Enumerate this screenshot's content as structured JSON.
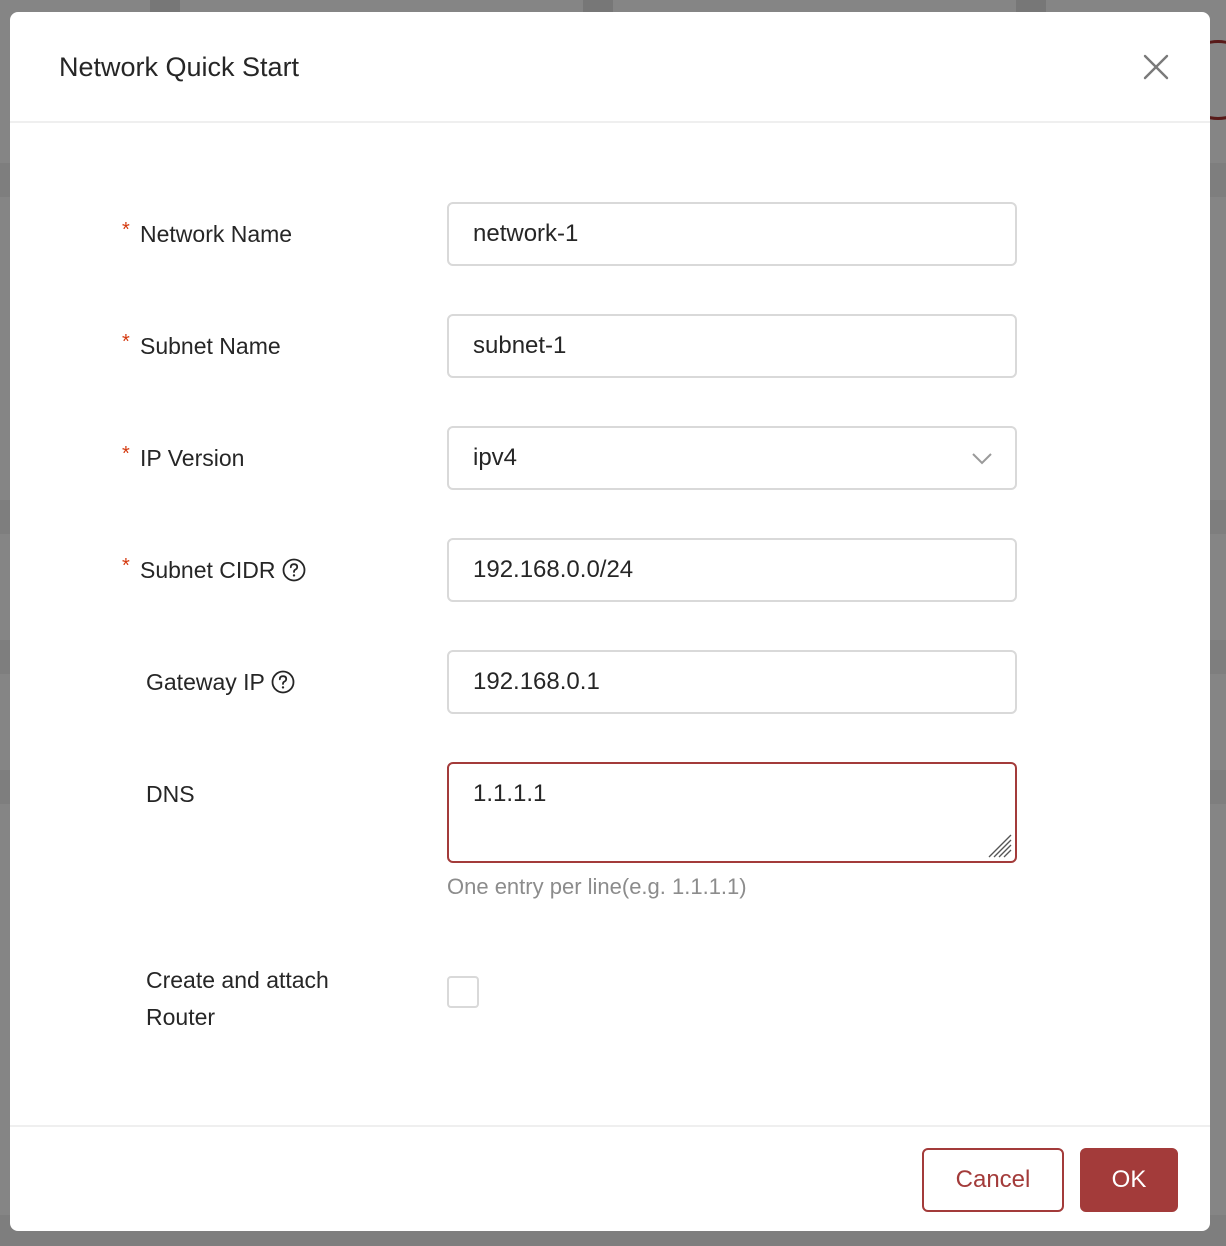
{
  "colors": {
    "accent": "#a33b3a",
    "required": "#d4380d",
    "border": "#d9d9d9",
    "hint": "#8c8c8c",
    "text": "#262626"
  },
  "modal": {
    "title": "Network Quick Start",
    "close_icon": "close-icon"
  },
  "form": {
    "network_name": {
      "label": "Network Name",
      "required": "*",
      "value": "network-1"
    },
    "subnet_name": {
      "label": "Subnet Name",
      "required": "*",
      "value": "subnet-1"
    },
    "ip_version": {
      "label": "IP Version",
      "required": "*",
      "value": "ipv4",
      "icon": "chevron-down-icon"
    },
    "subnet_cidr": {
      "label": "Subnet CIDR",
      "required": "*",
      "value": "192.168.0.0/24",
      "icon": "help-icon"
    },
    "gateway_ip": {
      "label": "Gateway IP",
      "value": "192.168.0.1",
      "icon": "help-icon"
    },
    "dns": {
      "label": "DNS",
      "value": "1.1.1.1",
      "hint": "One entry per line(e.g. 1.1.1.1)"
    },
    "router": {
      "label_line1": "Create and attach",
      "label_line2": "Router",
      "checked": false
    }
  },
  "footer": {
    "cancel_label": "Cancel",
    "ok_label": "OK"
  }
}
